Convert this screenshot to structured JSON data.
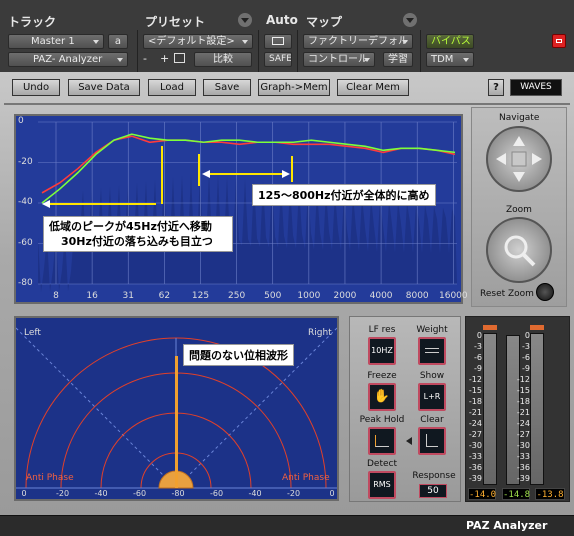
{
  "host": {
    "track_label": "トラック",
    "preset_label": "プリセット",
    "auto_label": "Auto",
    "map_label": "マップ",
    "track_name": "Master 1",
    "track_channel": "a",
    "insert_name": "PAZ- Analyzer",
    "preset_name": "<デフォルト設定>",
    "minus": "-",
    "plus": "+",
    "compare": "比較",
    "safe": "SAFE",
    "factory_default": "ファクトリーデフォル",
    "bypass": "バイパス",
    "control": "コントロール",
    "learn": "学習",
    "tdm": "TDM"
  },
  "toolbar": {
    "undo": "Undo",
    "save_data": "Save Data",
    "load": "Load",
    "save": "Save",
    "graph_mem": "Graph->Mem",
    "clear_mem": "Clear Mem",
    "help": "?",
    "brand": "WAVES"
  },
  "navigate": {
    "label": "Navigate",
    "zoom_label": "Zoom",
    "reset_zoom": "Reset Zoom"
  },
  "chart_data": {
    "type": "line",
    "y_ticks": [
      "0",
      "-20",
      "-40",
      "-60",
      "-80"
    ],
    "x_ticks": [
      "8",
      "16",
      "31",
      "62",
      "125",
      "250",
      "500",
      "1000",
      "2000",
      "4000",
      "8000",
      "16000"
    ],
    "ylim": [
      -80,
      0
    ],
    "series": [
      {
        "color": "#ff3b3b",
        "values": [
          -35,
          -30,
          -23,
          -15,
          -9,
          -7,
          -10,
          -9,
          -9,
          -10,
          -10,
          -11,
          -10,
          -10,
          -11,
          -11,
          -11,
          -12,
          -13,
          -15,
          -13,
          -13,
          -14,
          -16
        ]
      },
      {
        "color": "#7dff3b",
        "values": [
          -40,
          -33,
          -25,
          -16,
          -9,
          -6,
          -8,
          -9,
          -9,
          -10,
          -9,
          -9,
          -10,
          -10,
          -10,
          -9,
          -10,
          -11,
          -12,
          -14,
          -13,
          -13,
          -14,
          -15
        ]
      }
    ],
    "annotations": {
      "range_note": "125〜800Hz付近が全体的に高め",
      "peak_note_1": "低域のピークが45Hz付近へ移動",
      "peak_note_2": "30Hz付近の落ち込みも目立つ"
    }
  },
  "phase": {
    "left": "Left",
    "right": "Right",
    "anti_left": "Anti Phase",
    "anti_right": "Anti Phase",
    "note": "問題のない位相波形",
    "scale": [
      "0",
      "-20",
      "-40",
      "-60",
      "-80",
      "-60",
      "-40",
      "-20",
      "0"
    ]
  },
  "settings": {
    "lf_res_label": "LF res",
    "lf_res_value": "10HZ",
    "weight_label": "Weight",
    "freeze_label": "Freeze",
    "show_label": "Show",
    "show_value": "L+R",
    "peak_hold_label": "Peak Hold",
    "clear_label": "Clear",
    "detect_label": "Detect",
    "detect_value": "RMS",
    "response_label": "Response",
    "response_value": "50"
  },
  "meters": {
    "scale": [
      "0",
      "-3",
      "-6",
      "-9",
      "-12",
      "-15",
      "-18",
      "-21",
      "-24",
      "-27",
      "-30",
      "-33",
      "-36",
      "-39"
    ],
    "left_value": "-14.0",
    "mid_value": "-14.8",
    "right_value": "-13.8"
  },
  "footer": {
    "title": "PAZ Analyzer"
  }
}
